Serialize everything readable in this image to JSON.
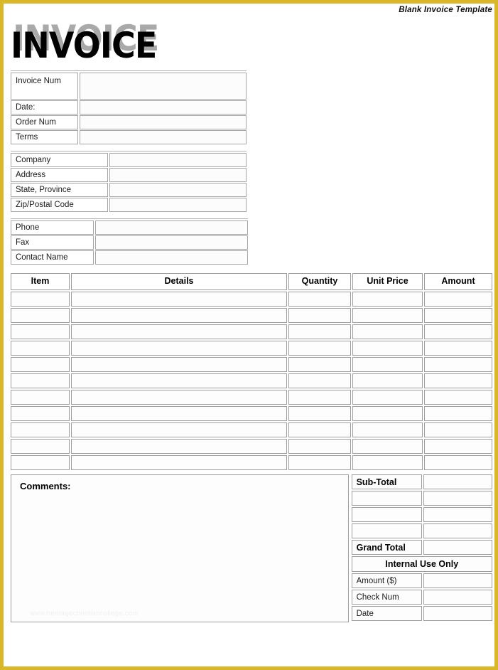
{
  "page": {
    "banner_title": "Blank Invoice Template",
    "border_color": "#d8b828",
    "wordmark": "INVOICE",
    "wordmark_shadow_color": "#a9a9a9",
    "watermark": "www.heritagechristiancollege.com"
  },
  "invoice_meta": {
    "rows": [
      {
        "label": "Invoice Num",
        "value": ""
      },
      {
        "label": "Date:",
        "value": ""
      },
      {
        "label": "Order Num",
        "value": ""
      },
      {
        "label": "Terms",
        "value": ""
      }
    ]
  },
  "company": {
    "rows": [
      {
        "label": "Company",
        "value": ""
      },
      {
        "label": "Address",
        "value": ""
      },
      {
        "label": "State, Province",
        "value": ""
      },
      {
        "label": "Zip/Postal Code",
        "value": ""
      }
    ]
  },
  "contact": {
    "rows": [
      {
        "label": "Phone",
        "value": ""
      },
      {
        "label": "Fax",
        "value": ""
      },
      {
        "label": "Contact Name",
        "value": ""
      }
    ]
  },
  "items_table": {
    "columns": [
      "Item",
      "Details",
      "Quantity",
      "Unit Price",
      "Amount"
    ],
    "rows": [
      {
        "item": "",
        "details": "",
        "quantity": "",
        "unit_price": "",
        "amount": ""
      },
      {
        "item": "",
        "details": "",
        "quantity": "",
        "unit_price": "",
        "amount": ""
      },
      {
        "item": "",
        "details": "",
        "quantity": "",
        "unit_price": "",
        "amount": ""
      },
      {
        "item": "",
        "details": "",
        "quantity": "",
        "unit_price": "",
        "amount": ""
      },
      {
        "item": "",
        "details": "",
        "quantity": "",
        "unit_price": "",
        "amount": ""
      },
      {
        "item": "",
        "details": "",
        "quantity": "",
        "unit_price": "",
        "amount": ""
      },
      {
        "item": "",
        "details": "",
        "quantity": "",
        "unit_price": "",
        "amount": ""
      },
      {
        "item": "",
        "details": "",
        "quantity": "",
        "unit_price": "",
        "amount": ""
      },
      {
        "item": "",
        "details": "",
        "quantity": "",
        "unit_price": "",
        "amount": ""
      },
      {
        "item": "",
        "details": "",
        "quantity": "",
        "unit_price": "",
        "amount": ""
      },
      {
        "item": "",
        "details": "",
        "quantity": "",
        "unit_price": "",
        "amount": ""
      }
    ]
  },
  "comments": {
    "label": "Comments:",
    "value": ""
  },
  "totals": {
    "sub_total_label": "Sub-Total",
    "sub_total_value": "",
    "blank_rows": [
      {
        "label": "",
        "value": ""
      },
      {
        "label": "",
        "value": ""
      },
      {
        "label": "",
        "value": ""
      }
    ],
    "grand_total_label": "Grand Total",
    "grand_total_value": "",
    "internal_header": "Internal Use Only",
    "internal_rows": [
      {
        "label": "Amount ($)",
        "value": ""
      },
      {
        "label": "Check Num",
        "value": ""
      },
      {
        "label": "Date",
        "value": ""
      }
    ]
  }
}
